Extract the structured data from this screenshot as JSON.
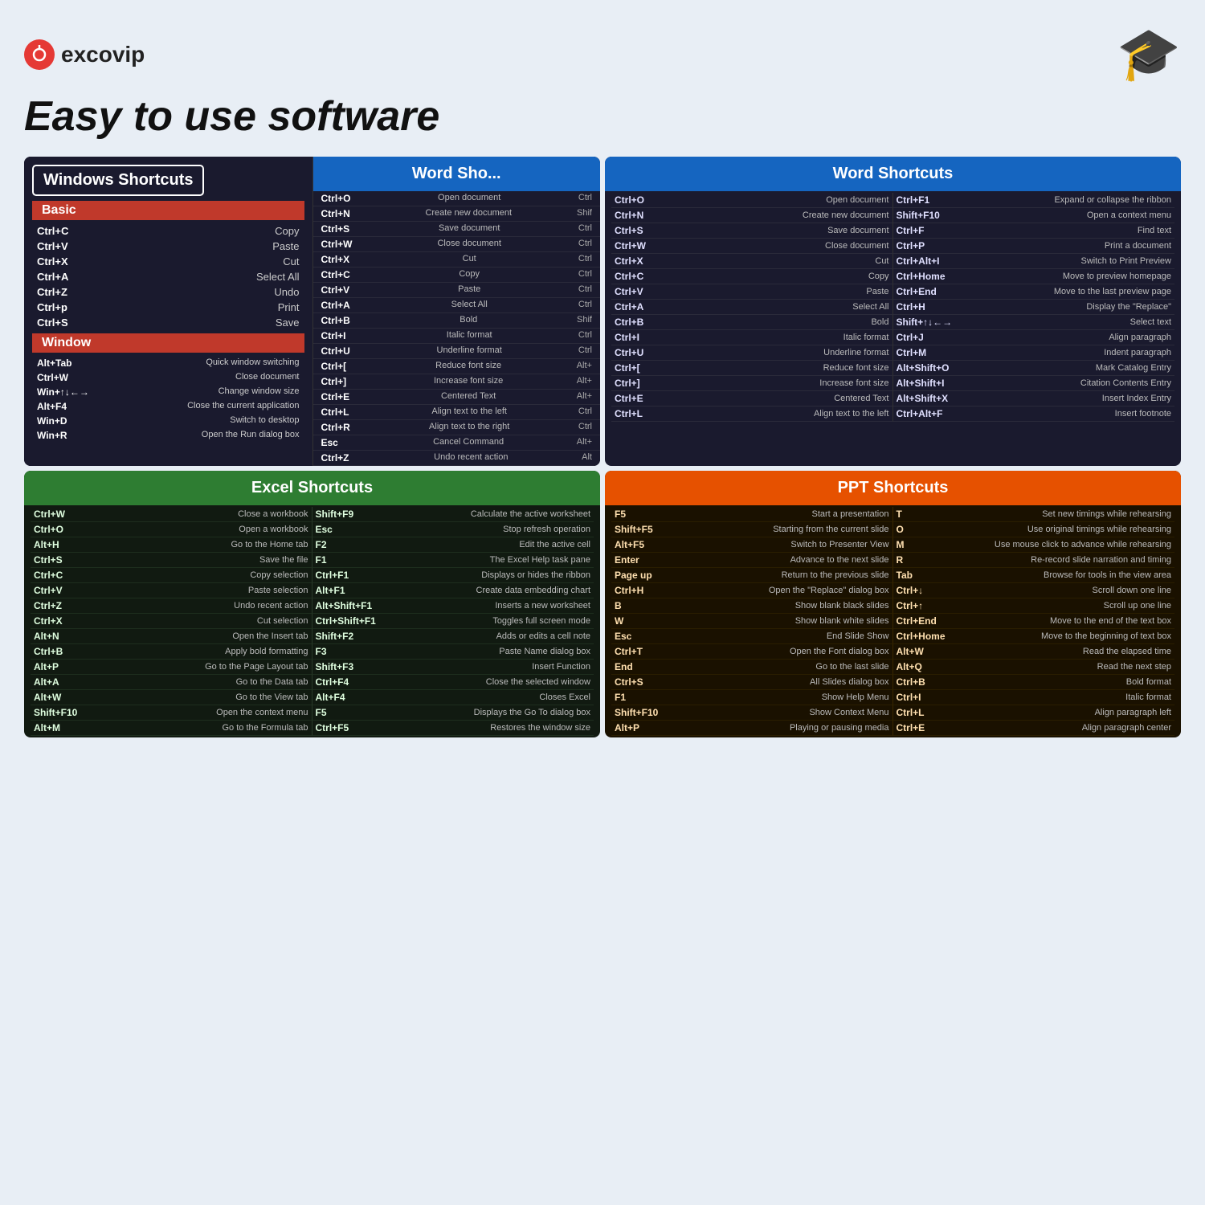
{
  "header": {
    "logo_text": "excovip",
    "tagline": "Easy to use software"
  },
  "windows": {
    "title": "Windows Shortcuts",
    "basic_label": "Basic",
    "basic_shortcuts": [
      {
        "key": "Ctrl+C",
        "desc": "Copy"
      },
      {
        "key": "Ctrl+V",
        "desc": "Paste"
      },
      {
        "key": "Ctrl+X",
        "desc": "Cut"
      },
      {
        "key": "Ctrl+A",
        "desc": "Select All"
      },
      {
        "key": "Ctrl+Z",
        "desc": "Undo"
      },
      {
        "key": "Ctrl+p",
        "desc": "Print"
      },
      {
        "key": "Ctrl+S",
        "desc": "Save"
      }
    ],
    "window_label": "Window",
    "window_shortcuts": [
      {
        "key": "Alt+Tab",
        "desc": "Quick window switching"
      },
      {
        "key": "Ctrl+W",
        "desc": "Close document"
      },
      {
        "key": "Win+↑↓←→",
        "desc": "Change window size"
      },
      {
        "key": "Alt+F4",
        "desc": "Close the current application"
      },
      {
        "key": "Win+D",
        "desc": "Switch to desktop"
      },
      {
        "key": "Win+R",
        "desc": "Open the Run dialog box"
      }
    ]
  },
  "word_left": {
    "title": "Word Sho...",
    "shortcuts": [
      {
        "key": "Ctrl+O",
        "desc": "Open document"
      },
      {
        "key": "Ctrl+N",
        "desc": "Create new document"
      },
      {
        "key": "Ctrl+S",
        "desc": "Save document"
      },
      {
        "key": "Ctrl+W",
        "desc": "Close document"
      },
      {
        "key": "Ctrl+X",
        "desc": "Cut"
      },
      {
        "key": "Ctrl+C",
        "desc": "Copy"
      },
      {
        "key": "Ctrl+V",
        "desc": "Paste"
      },
      {
        "key": "Ctrl+A",
        "desc": "Select All"
      },
      {
        "key": "Ctrl+B",
        "desc": "Bold"
      },
      {
        "key": "Ctrl+I",
        "desc": "Italic format"
      },
      {
        "key": "Ctrl+U",
        "desc": "Underline format"
      },
      {
        "key": "Ctrl+[",
        "desc": "Reduce font size"
      },
      {
        "key": "Ctrl+]",
        "desc": "Increase font size"
      },
      {
        "key": "Ctrl+E",
        "desc": "Centered Text"
      },
      {
        "key": "Ctrl+L",
        "desc": "Align text to the left"
      },
      {
        "key": "Ctrl+R",
        "desc": "Align text to the right"
      },
      {
        "key": "Esc",
        "desc": "Cancel Command"
      },
      {
        "key": "Ctrl+Z",
        "desc": "Undo recent action"
      }
    ],
    "shortcuts_right": [
      {
        "key": "Ctrl",
        "desc": ""
      },
      {
        "key": "Shif",
        "desc": ""
      },
      {
        "key": "Ctrl",
        "desc": ""
      },
      {
        "key": "Ctrl",
        "desc": ""
      },
      {
        "key": "Ctrl",
        "desc": ""
      },
      {
        "key": "Ctrl",
        "desc": ""
      },
      {
        "key": "Ctrl",
        "desc": ""
      },
      {
        "key": "Ctrl",
        "desc": ""
      },
      {
        "key": "Shif",
        "desc": ""
      },
      {
        "key": "Ctrl",
        "desc": ""
      },
      {
        "key": "Ctrl",
        "desc": ""
      },
      {
        "key": "Alt+",
        "desc": ""
      },
      {
        "key": "Alt+",
        "desc": ""
      },
      {
        "key": "Alt+",
        "desc": ""
      },
      {
        "key": "Ctrl",
        "desc": ""
      },
      {
        "key": "Ctrl",
        "desc": ""
      },
      {
        "key": "Alt+",
        "desc": ""
      },
      {
        "key": "Alt",
        "desc": ""
      }
    ]
  },
  "word_right": {
    "title": "Word Shortcuts",
    "left_shortcuts": [
      {
        "key": "Ctrl+O",
        "desc": "Open document"
      },
      {
        "key": "Ctrl+N",
        "desc": "Create new document"
      },
      {
        "key": "Ctrl+S",
        "desc": "Save document"
      },
      {
        "key": "Ctrl+W",
        "desc": "Close document"
      },
      {
        "key": "Ctrl+X",
        "desc": "Cut"
      },
      {
        "key": "Ctrl+C",
        "desc": "Copy"
      },
      {
        "key": "Ctrl+V",
        "desc": "Paste"
      },
      {
        "key": "Ctrl+A",
        "desc": "Select All"
      },
      {
        "key": "Ctrl+B",
        "desc": "Bold"
      },
      {
        "key": "Ctrl+I",
        "desc": "Italic format"
      },
      {
        "key": "Ctrl+U",
        "desc": "Underline format"
      },
      {
        "key": "Ctrl+[",
        "desc": "Reduce font size"
      },
      {
        "key": "Ctrl+]",
        "desc": "Increase font size"
      },
      {
        "key": "Ctrl+E",
        "desc": "Centered Text"
      },
      {
        "key": "Ctrl+L",
        "desc": "Align text to the left"
      }
    ],
    "right_shortcuts": [
      {
        "key": "Ctrl+F1",
        "desc": "Expand or collapse the ribbon"
      },
      {
        "key": "Shift+F10",
        "desc": "Open a context menu"
      },
      {
        "key": "Ctrl+F",
        "desc": "Find text"
      },
      {
        "key": "Ctrl+P",
        "desc": "Print a document"
      },
      {
        "key": "Ctrl+Alt+I",
        "desc": "Switch to Print Preview"
      },
      {
        "key": "Ctrl+Home",
        "desc": "Move to preview homepage"
      },
      {
        "key": "Ctrl+End",
        "desc": "Move to the last preview page"
      },
      {
        "key": "Ctrl+H",
        "desc": "Display the \"Replace\""
      },
      {
        "key": "Shift+↑↓←→",
        "desc": "Select text"
      },
      {
        "key": "Ctrl+J",
        "desc": "Align paragraph"
      },
      {
        "key": "Ctrl+M",
        "desc": "Indent paragraph"
      },
      {
        "key": "Alt+Shift+O",
        "desc": "Mark Catalog Entry"
      },
      {
        "key": "Alt+Shift+I",
        "desc": "Citation Contents Entry"
      },
      {
        "key": "Alt+Shift+X",
        "desc": "Insert Index Entry"
      },
      {
        "key": "Ctrl+Alt+F",
        "desc": "Insert footnote"
      }
    ]
  },
  "excel": {
    "title": "Excel Shortcuts",
    "left_shortcuts": [
      {
        "key": "Ctrl+W",
        "desc": "Close a workbook"
      },
      {
        "key": "Ctrl+O",
        "desc": "Open a workbook"
      },
      {
        "key": "Alt+H",
        "desc": "Go to the Home tab"
      },
      {
        "key": "Ctrl+S",
        "desc": "Save the file"
      },
      {
        "key": "Ctrl+C",
        "desc": "Copy selection"
      },
      {
        "key": "Ctrl+V",
        "desc": "Paste selection"
      },
      {
        "key": "Ctrl+Z",
        "desc": "Undo recent action"
      },
      {
        "key": "Ctrl+X",
        "desc": "Cut selection"
      },
      {
        "key": "Alt+N",
        "desc": "Open the Insert tab"
      },
      {
        "key": "Ctrl+B",
        "desc": "Apply bold formatting"
      },
      {
        "key": "Alt+P",
        "desc": "Go to the Page Layout tab"
      },
      {
        "key": "Alt+A",
        "desc": "Go to the Data tab"
      },
      {
        "key": "Alt+W",
        "desc": "Go to the View tab"
      },
      {
        "key": "Shift+F10",
        "desc": "Open the context menu"
      },
      {
        "key": "Alt+M",
        "desc": "Go to the Formula tab"
      }
    ],
    "right_shortcuts": [
      {
        "key": "Shift+F9",
        "desc": "Calculate the active worksheet"
      },
      {
        "key": "Esc",
        "desc": "Stop refresh operation"
      },
      {
        "key": "F2",
        "desc": "Edit the active cell"
      },
      {
        "key": "F1",
        "desc": "The Excel Help task pane"
      },
      {
        "key": "Ctrl+F1",
        "desc": "Displays or hides the ribbon"
      },
      {
        "key": "Alt+F1",
        "desc": "Create data embedding chart"
      },
      {
        "key": "Alt+Shift+F1",
        "desc": "Inserts a new worksheet"
      },
      {
        "key": "Ctrl+Shift+F1",
        "desc": "Toggles full screen mode"
      },
      {
        "key": "Shift+F2",
        "desc": "Adds or edits a cell note"
      },
      {
        "key": "F3",
        "desc": "Paste Name dialog box"
      },
      {
        "key": "Shift+F3",
        "desc": "Insert Function"
      },
      {
        "key": "Ctrl+F4",
        "desc": "Close the selected window"
      },
      {
        "key": "Alt+F4",
        "desc": "Closes Excel"
      },
      {
        "key": "F5",
        "desc": "Displays the Go To dialog box"
      },
      {
        "key": "Ctrl+F5",
        "desc": "Restores the window size"
      }
    ]
  },
  "ppt": {
    "title": "PPT Shortcuts",
    "left_shortcuts": [
      {
        "key": "F5",
        "desc": "Start a presentation"
      },
      {
        "key": "Shift+F5",
        "desc": "Starting from the current slide"
      },
      {
        "key": "Alt+F5",
        "desc": "Switch to Presenter View"
      },
      {
        "key": "Enter",
        "desc": "Advance to the next slide"
      },
      {
        "key": "Page up",
        "desc": "Return to the previous slide"
      },
      {
        "key": "Ctrl+H",
        "desc": "Open the \"Replace\" dialog box"
      },
      {
        "key": "B",
        "desc": "Show blank black slides"
      },
      {
        "key": "W",
        "desc": "Show blank white slides"
      },
      {
        "key": "Esc",
        "desc": "End Slide Show"
      },
      {
        "key": "Ctrl+T",
        "desc": "Open the Font dialog box"
      },
      {
        "key": "End",
        "desc": "Go to the last slide"
      },
      {
        "key": "Ctrl+S",
        "desc": "All Slides dialog box"
      },
      {
        "key": "F1",
        "desc": "Show Help Menu"
      },
      {
        "key": "Shift+F10",
        "desc": "Show Context Menu"
      },
      {
        "key": "Alt+P",
        "desc": "Playing or pausing media"
      }
    ],
    "right_shortcuts": [
      {
        "key": "T",
        "desc": "Set new timings while rehearsing"
      },
      {
        "key": "O",
        "desc": "Use original timings while rehearsing"
      },
      {
        "key": "M",
        "desc": "Use mouse click to advance while rehearsing"
      },
      {
        "key": "R",
        "desc": "Re-record slide narration and timing"
      },
      {
        "key": "Tab",
        "desc": "Browse for tools in the view area"
      },
      {
        "key": "Ctrl+↓",
        "desc": "Scroll down one line"
      },
      {
        "key": "Ctrl+↑",
        "desc": "Scroll up one line"
      },
      {
        "key": "Ctrl+End",
        "desc": "Move to the end of the text box"
      },
      {
        "key": "Ctrl+Home",
        "desc": "Move to the beginning of text box"
      },
      {
        "key": "Alt+W",
        "desc": "Read the elapsed time"
      },
      {
        "key": "Alt+Q",
        "desc": "Read the next step"
      },
      {
        "key": "Ctrl+B",
        "desc": "Bold format"
      },
      {
        "key": "Ctrl+I",
        "desc": "Italic format"
      },
      {
        "key": "Ctrl+L",
        "desc": "Align paragraph left"
      },
      {
        "key": "Ctrl+E",
        "desc": "Align paragraph center"
      }
    ]
  }
}
